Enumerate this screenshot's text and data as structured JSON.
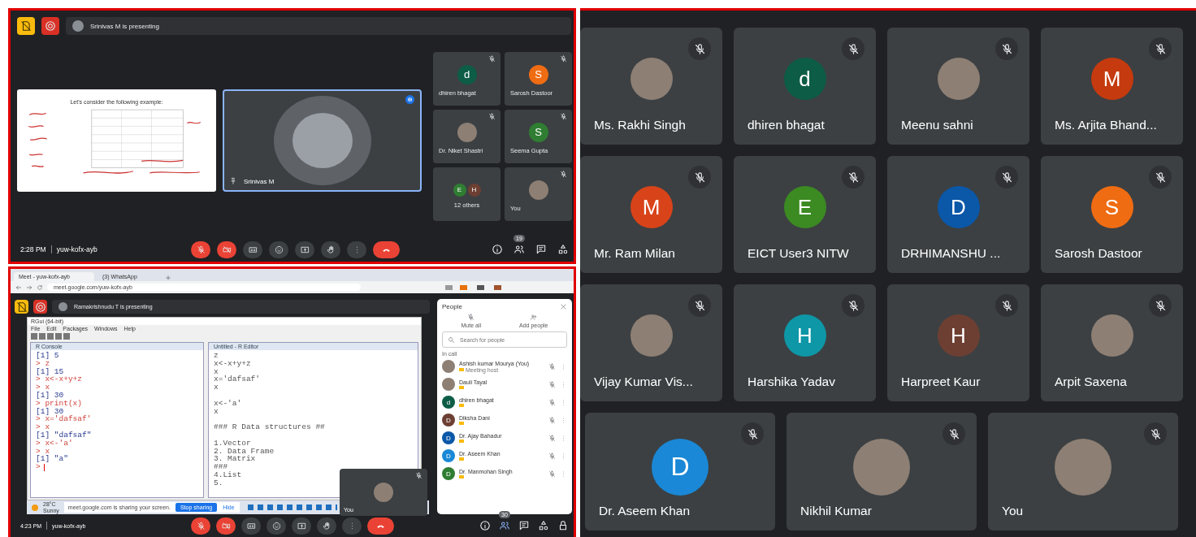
{
  "meeting_top": {
    "presenting_banner": "Srinivas M is presenting",
    "slide": {
      "title": "Let's consider the following example:"
    },
    "presenter": {
      "name": "Srinivas M",
      "speaking": true
    },
    "side_tiles": [
      {
        "kind": "initial",
        "name": "dhiren bhagat",
        "letter": "d",
        "color": "#0d5c46",
        "muted": true
      },
      {
        "kind": "initial",
        "name": "Sarosh Dastoor",
        "letter": "S",
        "color": "#ef6c13",
        "muted": true
      },
      {
        "kind": "photo",
        "name": "Dr. Niket Shastri",
        "muted": true
      },
      {
        "kind": "initial",
        "name": "Seema Gupta",
        "letter": "S",
        "color": "#2f7d32",
        "muted": true
      },
      {
        "kind": "others",
        "name": "12 others",
        "letters": [
          {
            "letter": "E",
            "color": "#2f7d32"
          },
          {
            "letter": "H",
            "color": "#6d3f32"
          }
        ],
        "muted": false
      },
      {
        "kind": "photo",
        "name": "You",
        "muted": true
      }
    ],
    "time": "2:28 PM",
    "meeting_code": "yuw-kofx-ayb",
    "people_count": "19",
    "controls": [
      {
        "kind": "mic",
        "off": true
      },
      {
        "kind": "camera",
        "off": true
      },
      {
        "kind": "captions",
        "off": false
      },
      {
        "kind": "emoji",
        "off": false
      },
      {
        "kind": "present",
        "off": false
      },
      {
        "kind": "hand",
        "off": false
      },
      {
        "kind": "more",
        "off": false
      },
      {
        "kind": "leave"
      }
    ]
  },
  "meeting_bottom": {
    "browser_tabs": [
      {
        "title": "Meet - yuw-kofx-ayb",
        "selected": true
      },
      {
        "title": "(3) WhatsApp",
        "selected": false
      }
    ],
    "url": "meet.google.com/yuw-kofx-ayb",
    "presenting_banner": "Ramakrishnudu T is presenting",
    "rgui": {
      "title": "RGui (64-bit)",
      "menu": [
        "File",
        "Edit",
        "Packages",
        "Windows",
        "Help"
      ],
      "console_title": "R Console",
      "editor_title": "Untitled - R Editor",
      "console_lines": [
        {
          "kind": "output",
          "text": "[1] 5"
        },
        {
          "kind": "input",
          "text": "> z"
        },
        {
          "kind": "output",
          "text": "[1] 15"
        },
        {
          "kind": "input",
          "text": "> x<-x+y+z"
        },
        {
          "kind": "input",
          "text": "> x"
        },
        {
          "kind": "output",
          "text": "[1] 30"
        },
        {
          "kind": "input",
          "text": "> print(x)"
        },
        {
          "kind": "output",
          "text": "[1] 30"
        },
        {
          "kind": "input",
          "text": "> x='dafsaf'"
        },
        {
          "kind": "input",
          "text": "> x"
        },
        {
          "kind": "output",
          "text": "[1] \"dafsaf\""
        },
        {
          "kind": "input",
          "text": "> x<-'a'"
        },
        {
          "kind": "input",
          "text": "> x"
        },
        {
          "kind": "output",
          "text": "[1] \"a\""
        },
        {
          "kind": "prompt",
          "text": ">"
        }
      ],
      "editor_blocks": [
        {
          "lines": [
            "z",
            "x<-x+y+z",
            "x",
            "x='dafsaf'",
            "x"
          ]
        },
        {
          "lines": [
            "x<-'a'",
            "x"
          ]
        },
        {
          "lines": [
            "### R Data structures ##"
          ]
        },
        {
          "lines": [
            "1.Vector",
            "2. Data Frame",
            "3. Matrix",
            "###",
            "4.List",
            "5."
          ]
        }
      ]
    },
    "taskbar": {
      "weather": "28°C",
      "weather_note": "Sunny",
      "sharing_note": "meet.google.com is sharing your screen.",
      "stop_button": "Stop sharing",
      "hide_button": "Hide"
    },
    "self_tile": {
      "name": "You",
      "muted": true
    },
    "people_panel": {
      "title": "People",
      "mute_all": "Mute all",
      "add_people": "Add people",
      "search_placeholder": "Search for people",
      "section": "In call",
      "people": [
        {
          "kind": "photo",
          "name": "Ashish kumar Mourya (You)",
          "role": "Meeting host"
        },
        {
          "kind": "photo",
          "name": "Dauli Tayal"
        },
        {
          "kind": "initial",
          "name": "dhiren bhagat",
          "letter": "d",
          "color": "#0d5c46"
        },
        {
          "kind": "initial",
          "name": "Diksha Dani",
          "letter": "D",
          "color": "#6d3f32"
        },
        {
          "kind": "initial",
          "name": "Dr. Ajay Bahadur",
          "letter": "D",
          "color": "#0b57a8"
        },
        {
          "kind": "initial",
          "name": "Dr. Aseem Khan",
          "letter": "D",
          "color": "#1a88d6"
        },
        {
          "kind": "initial",
          "name": "Dr. Manmohan Singh",
          "letter": "D",
          "color": "#2f7d32"
        }
      ]
    },
    "time": "4:23 PM",
    "meeting_code": "yuw-kofx-ayb",
    "people_count": "30",
    "controls": [
      {
        "kind": "mic",
        "off": true
      },
      {
        "kind": "camera",
        "off": true
      },
      {
        "kind": "captions",
        "off": false
      },
      {
        "kind": "emoji",
        "off": false
      },
      {
        "kind": "present",
        "off": false
      },
      {
        "kind": "hand",
        "off": false
      },
      {
        "kind": "more",
        "off": false
      },
      {
        "kind": "leave"
      }
    ]
  },
  "grid": {
    "rows": [
      {
        "tiles": [
          {
            "kind": "photo",
            "name": "Ms. Rakhi Singh",
            "muted": true
          },
          {
            "kind": "initial",
            "name": "dhiren bhagat",
            "letter": "d",
            "color": "#0d5c46",
            "muted": true
          },
          {
            "kind": "photo",
            "name": "Meenu sahni",
            "muted": true
          },
          {
            "kind": "initial",
            "name": "Ms. Arjita Bhand...",
            "letter": "M",
            "color": "#c53a0e",
            "muted": true
          }
        ]
      },
      {
        "tiles": [
          {
            "kind": "initial",
            "name": "Mr. Ram Milan",
            "letter": "M",
            "color": "#d9431a",
            "muted": true
          },
          {
            "kind": "initial",
            "name": "EICT User3 NITW",
            "letter": "E",
            "color": "#3b8a22",
            "muted": true
          },
          {
            "kind": "initial",
            "name": "DRHIMANSHU ...",
            "letter": "D",
            "color": "#0b57a8",
            "muted": true
          },
          {
            "kind": "initial",
            "name": "Sarosh Dastoor",
            "letter": "S",
            "color": "#ef6c13",
            "muted": true
          }
        ]
      },
      {
        "tiles": [
          {
            "kind": "photo",
            "name": "Vijay Kumar Vis...",
            "muted": true
          },
          {
            "kind": "initial",
            "name": "Harshika Yadav",
            "letter": "H",
            "color": "#0e97a6",
            "muted": true
          },
          {
            "kind": "initial",
            "name": "Harpreet Kaur",
            "letter": "H",
            "color": "#6d3f32",
            "muted": true
          },
          {
            "kind": "photo",
            "name": "Arpit Saxena",
            "muted": true
          }
        ]
      },
      {
        "tiles": [
          {
            "kind": "initial",
            "name": "Dr. Aseem Khan",
            "letter": "D",
            "color": "#1a88d6",
            "muted": true
          },
          {
            "kind": "photo",
            "name": "Nikhil Kumar",
            "muted": true
          },
          {
            "kind": "photo",
            "name": "You",
            "muted": true
          }
        ]
      }
    ]
  }
}
